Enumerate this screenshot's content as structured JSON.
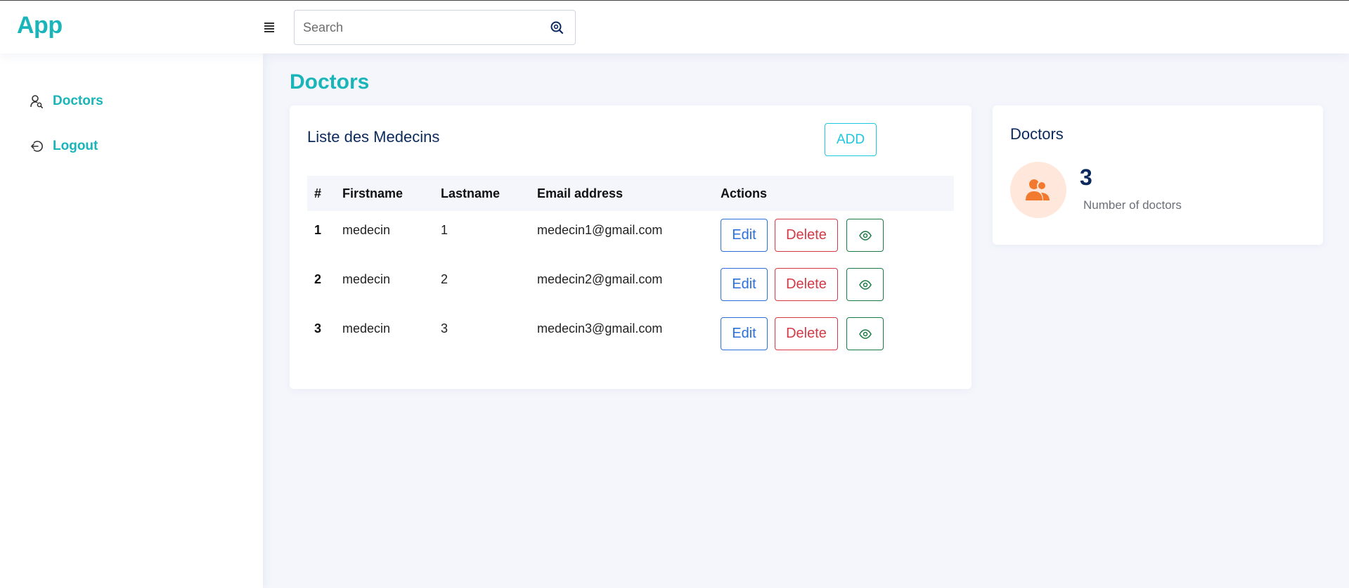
{
  "header": {
    "logo": "App",
    "menu_icon": "hamburger-menu-icon",
    "search_placeholder": "Search",
    "search_icon": "search-icon"
  },
  "sidebar": {
    "items": [
      {
        "label": "Doctors",
        "icon": "user-search-icon"
      },
      {
        "label": "Logout",
        "icon": "logout-icon"
      }
    ]
  },
  "main": {
    "page_title": "Doctors",
    "list_card": {
      "title": "Liste des Medecins",
      "add_label": "ADD",
      "columns": [
        "#",
        "Firstname",
        "Lastname",
        "Email address",
        "Actions"
      ],
      "rows": [
        {
          "index": "1",
          "firstname": "medecin",
          "lastname": "1",
          "email": "medecin1@gmail.com"
        },
        {
          "index": "2",
          "firstname": "medecin",
          "lastname": "2",
          "email": "medecin2@gmail.com"
        },
        {
          "index": "3",
          "firstname": "medecin",
          "lastname": "3",
          "email": "medecin3@gmail.com"
        }
      ],
      "edit_label": "Edit",
      "delete_label": "Delete",
      "view_icon": "eye-icon"
    },
    "stat_card": {
      "title": "Doctors",
      "value": "3",
      "label": "Number of doctors",
      "icon": "users-icon"
    }
  },
  "colors": {
    "brand": "#19b5b9",
    "navy": "#0b2a5b",
    "edit": "#2a6fdb",
    "delete": "#d23a47",
    "view": "#1c7a45",
    "add": "#1ec8de",
    "stat_icon": "#f27a2e",
    "stat_icon_bg": "#ffe8db"
  }
}
